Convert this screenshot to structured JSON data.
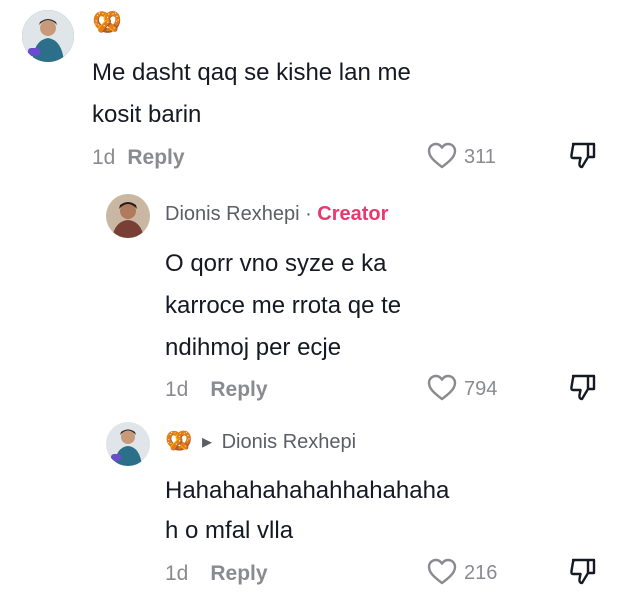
{
  "comments": [
    {
      "username": "🥨",
      "text_lines": [
        "Me dasht qaq se kishe lan me",
        "kosit barin"
      ],
      "time": "1d",
      "reply_label": "Reply",
      "likes": "311"
    },
    {
      "username": "Dionis Rexhepi",
      "separator": " · ",
      "badge": "Creator",
      "text_lines": [
        "O qorr vno syze e ka",
        "karroce me rrota qe te",
        "ndihmoj per ecje"
      ],
      "time": "1d",
      "reply_label": "Reply",
      "likes": "794"
    },
    {
      "username": "🥨",
      "reply_to_arrow": "▸",
      "reply_to": "Dionis Rexhepi",
      "text_lines": [
        "Hahahahahahahhahahaha",
        "h o mfal vlla"
      ],
      "time": "1d",
      "reply_label": "Reply",
      "likes": "216"
    }
  ],
  "colors": {
    "creator": "#e8386f",
    "muted": "#8a8b91",
    "text": "#161823"
  },
  "icons": [
    "heart-icon",
    "dislike-icon",
    "pretzel-emoji"
  ]
}
